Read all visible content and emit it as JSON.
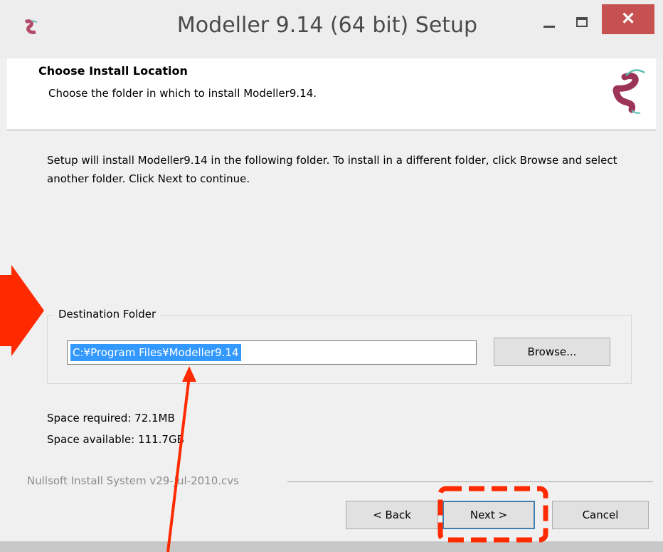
{
  "window": {
    "title": "Modeller 9.14 (64 bit) Setup",
    "close_glyph": "✕"
  },
  "header": {
    "title": "Choose Install Location",
    "subtitle": "Choose the folder in which to install Modeller9.14."
  },
  "body": {
    "instructions": "Setup will install Modeller9.14 in the following folder. To install in a different folder, click Browse and select another folder. Click Next to continue."
  },
  "destination": {
    "group_label": "Destination Folder",
    "path_value": "C:¥Program Files¥Modeller9.14",
    "browse_label": "Browse..."
  },
  "space": {
    "required": "Space required: 72.1MB",
    "available": "Space available: 111.7GB"
  },
  "footer": {
    "branding": "Nullsoft Install System v29-Jul-2010.cvs",
    "back_label": "< Back",
    "next_label": "Next >",
    "cancel_label": "Cancel"
  },
  "annotation_colors": {
    "arrow": "#ff2a00",
    "highlight_box": "#ff2a00"
  }
}
